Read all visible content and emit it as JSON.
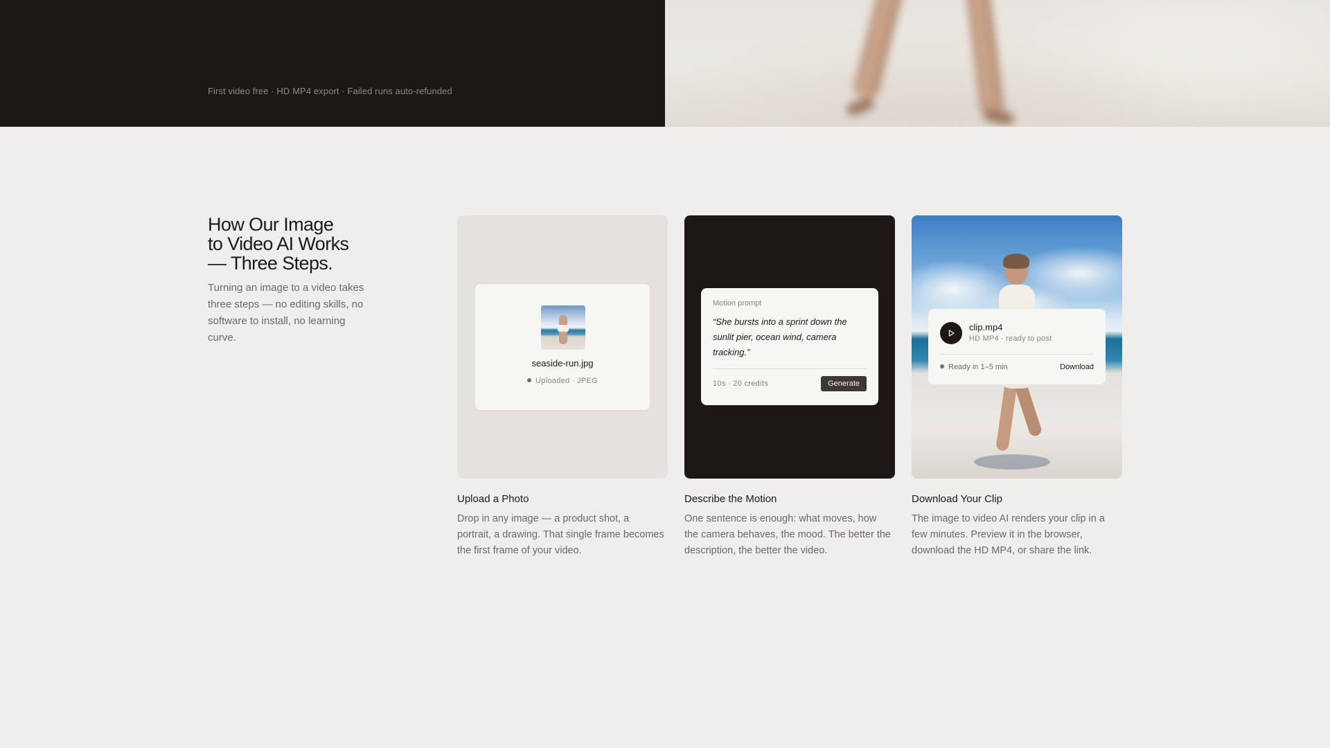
{
  "hero": {
    "note": "First video free · HD MP4 export · Failed runs auto-refunded"
  },
  "section": {
    "title": "How Our Image\nto Video AI Works\n— Three Steps.",
    "subtitle": "Turning an image to a video takes three steps — no editing skills, no software to install, no learning curve."
  },
  "steps": [
    {
      "title": "Upload a Photo",
      "description": "Drop in any image — a product shot, a portrait, a drawing. That single frame becomes the first frame of your video.",
      "file_name": "seaside-run.jpg",
      "file_status": "Uploaded · JPEG"
    },
    {
      "title": "Describe the Motion",
      "description": "One sentence is enough: what moves, how the camera behaves, the mood. The better the description, the better the video.",
      "prompt_label": "Motion prompt",
      "prompt_text": "“She bursts into a sprint down the sunlit pier, ocean wind, camera tracking.”",
      "prompt_meta": "10s · 20 credits",
      "generate_label": "Generate"
    },
    {
      "title": "Download Your Clip",
      "description": "The image to video AI renders your clip in a few minutes. Preview it in the browser, download the HD MP4, or share the link.",
      "clip_name": "clip.mp4",
      "clip_meta": "HD MP4 · ready to post",
      "ready_text": "Ready in 1–5 min",
      "download_label": "Download"
    }
  ],
  "icons": {
    "play": "play-icon",
    "status_dot": "status-dot-icon"
  },
  "colors": {
    "dark": "#1d1816",
    "background": "#efeeec",
    "status_green": "#5f7a68"
  }
}
